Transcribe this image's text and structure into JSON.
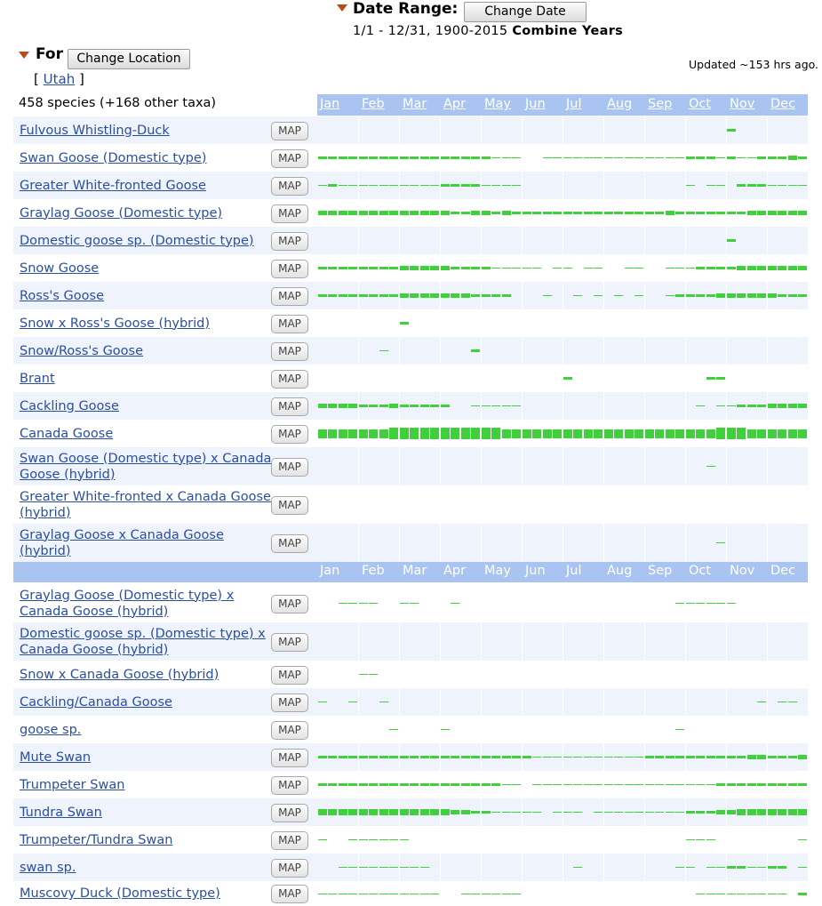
{
  "date_range": {
    "title": "Date Range:",
    "button": "Change Date",
    "subtitle_range": "1/1 - 12/31, 1900-2015",
    "subtitle_bold": "Combine Years"
  },
  "location": {
    "title": "For",
    "button": "Change Location",
    "bracket_open": "[",
    "bracket_close": "]",
    "name": "Utah"
  },
  "updated": "Updated ~153 hrs ago.",
  "species_count": "458 species (+168 other taxa)",
  "map_label": "MAP",
  "months": [
    "Jan",
    "Feb",
    "Mar",
    "Apr",
    "May",
    "Jun",
    "Jul",
    "Aug",
    "Sep",
    "Oct",
    "Nov",
    "Dec"
  ],
  "colors": {
    "header": "#a9c4f0",
    "bar": "#3fd03c",
    "alt_row": "#eef3fc",
    "link": "#2a4fa0"
  },
  "rows": [
    {
      "name": "Fulvous Whistling-Duck",
      "freq": "0020000000000000000000000000000000000000200000000000000000002000000000000"
    },
    {
      "name": "Swan Goose (Domestic type)",
      "freq": "22222222222222222222222211111000111111111111111111111222212212122222322"
    },
    {
      "name": "Greater White-fronted Goose",
      "freq": "123111111111111121222222211111000000000000000000000000001011100222221111212"
    },
    {
      "name": "Graylag Goose (Domestic type)",
      "freq": "33333333333333333322233332322222222222222222222222322222222222333333333"
    },
    {
      "name": "Domestic goose sp. (Domestic type)",
      "freq": "0000000000000000000000000000000000000000000000000000000000002000000000000"
    },
    {
      "name": "Snow Goose",
      "freq": "22222222222333333332222222111110101111001100011110001111122222233333333332"
    },
    {
      "name": "Ross's Goose",
      "freq": "22222222222333333333332222210010100010010010010001122222233333333322222"
    },
    {
      "name": "Snow x Ross's Goose (hybrid)",
      "freq": "0000000000002000000000000000000000000000000000000000000000000200000000000"
    },
    {
      "name": "Snow/Ross's Goose",
      "freq": "0020000001020000000000200000000000000000000000000000000000200000000000000"
    },
    {
      "name": "Brant",
      "freq": "0000000000000000000000000000000000002000000000000000000002220000000000000"
    },
    {
      "name": "Cackling Goose",
      "freq": "33333322223222222222000111110101000000000000000000000000010111222223333333"
    },
    {
      "name": "Canada Goose",
      "freq": "55555555556666666666666666655555555555555555555555555555555666665555555555"
    },
    {
      "name": "Swan Goose (Domestic type) x Canada Goose (hybrid)",
      "freq": "0000000000000000000000000000000000000000000000000000000001000000000000000"
    },
    {
      "name": "Greater White-fronted x Canada Goose (hybrid)",
      "freq": "0010000000000000000000000000000000000000000000000000000000000000000000001"
    },
    {
      "name": "Graylag Goose x Canada Goose (hybrid)",
      "freq": "0000000000000000000000000000000000000000000000000000000000110100000000000"
    }
  ],
  "rows2": [
    {
      "name": "Graylag Goose (Domestic type) x Canada Goose (hybrid)",
      "freq": "001111111000101000011000000000000000000000000000000000111101111000000000001"
    },
    {
      "name": "Domestic goose sp. (Domestic type) x Canada Goose (hybrid)",
      "freq": "0000000000000000000000000000000000000000000000000000000100000000000000000"
    },
    {
      "name": "Snow x Canada Goose (hybrid)",
      "freq": "0000001100010000000000000000000000000000000000000000000000000000000000000"
    },
    {
      "name": "Cackling/Canada Goose",
      "freq": "1000110001010000000000000000000000000000000000000000000000000000010011000"
    },
    {
      "name": "goose sp.",
      "freq": "0000000000010000000100000000000000000000000000000000000110010010000000000001"
    },
    {
      "name": "Mute Swan",
      "freq": "22222222222222222222222222222222111111111111111122222222222222223332222232"
    },
    {
      "name": "Trumpeter Swan",
      "freq": "22222222222222222222222222211101111101111111111111111111111122222222222222"
    },
    {
      "name": "Tundra Swan",
      "freq": "44444444444444444443333222111111100101110111111111111112222233344444444444"
    },
    {
      "name": "Trumpeter/Tundra Swan",
      "freq": "1000101111111000000000000000000000000000000000000000001111100000000000011"
    },
    {
      "name": "swan sp.",
      "freq": "0011111111111101000000000000000000000010000000000000011101112221112220011"
    },
    {
      "name": "Muscovy Duck (Domestic type)",
      "freq": "11111111111111111101011111111100000000000000000000000010111111111111110121"
    }
  ]
}
